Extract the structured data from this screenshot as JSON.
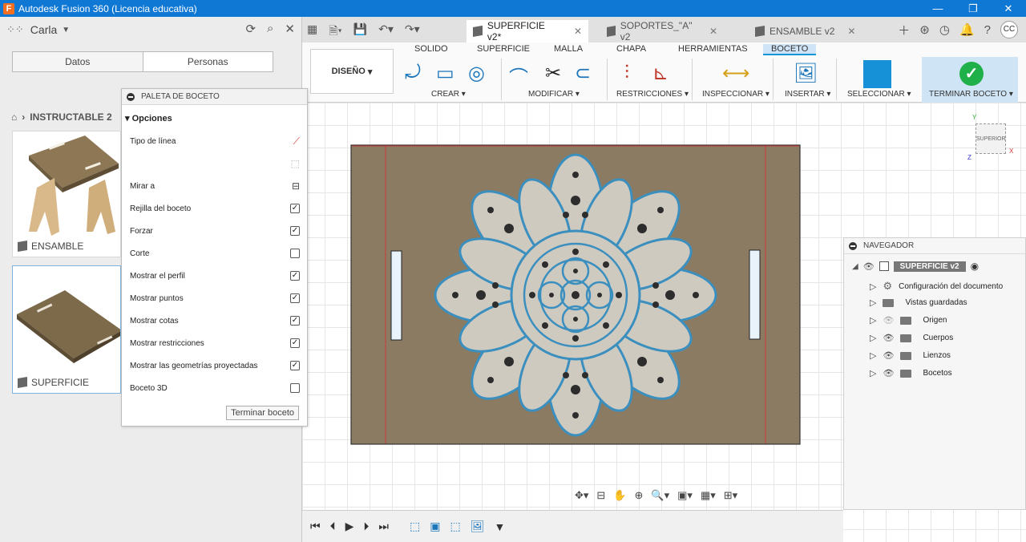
{
  "window": {
    "title": "Autodesk Fusion 360 (Licencia educativa)"
  },
  "data_panel": {
    "user": "Carla",
    "tabs": [
      "Datos",
      "Personas"
    ],
    "breadcrumb": "INSTRUCTABLE 2",
    "cards": [
      {
        "label": "ENSAMBLE"
      },
      {
        "label": "SUPERFICIE"
      }
    ]
  },
  "doc_tabs": [
    {
      "label": "SUPERFICIE v2*",
      "active": true
    },
    {
      "label": "SOPORTES_\"A\" v2",
      "active": false
    },
    {
      "label": "ENSAMBLE v2",
      "active": false
    }
  ],
  "user_initials": "CC",
  "ribbon": {
    "workspace": "DISEÑO",
    "tabs": [
      "SOLIDO",
      "SUPERFICIE",
      "MALLA",
      "CHAPA",
      "HERRAMIENTAS",
      "BOCETO"
    ],
    "active_tab": "BOCETO",
    "groups": [
      "CREAR",
      "MODIFICAR",
      "RESTRICCIONES",
      "INSPECCIONAR",
      "INSERTAR",
      "SELECCIONAR",
      "TERMINAR BOCETO"
    ]
  },
  "palette": {
    "title": "PALETA DE BOCETO",
    "section": "Opciones",
    "rows": [
      {
        "label": "Tipo de línea",
        "kind": "icon"
      },
      {
        "label": "",
        "kind": "icon"
      },
      {
        "label": "Mirar a",
        "kind": "icon"
      },
      {
        "label": "Rejilla del boceto",
        "kind": "checkbox",
        "checked": true
      },
      {
        "label": "Forzar",
        "kind": "checkbox",
        "checked": true
      },
      {
        "label": "Corte",
        "kind": "checkbox",
        "checked": false
      },
      {
        "label": "Mostrar el perfil",
        "kind": "checkbox",
        "checked": true
      },
      {
        "label": "Mostrar puntos",
        "kind": "checkbox",
        "checked": true
      },
      {
        "label": "Mostrar cotas",
        "kind": "checkbox",
        "checked": true
      },
      {
        "label": "Mostrar restricciones",
        "kind": "checkbox",
        "checked": true
      },
      {
        "label": "Mostrar las geometrías proyectadas",
        "kind": "checkbox",
        "checked": true
      },
      {
        "label": "Boceto 3D",
        "kind": "checkbox",
        "checked": false
      }
    ],
    "finish_button": "Terminar boceto"
  },
  "viewcube": {
    "face": "SUPERIOR"
  },
  "navigator": {
    "title": "NAVEGADOR",
    "root": "SUPERFICIE v2",
    "items": [
      {
        "label": "Configuración del documento",
        "icon": "gear-icon"
      },
      {
        "label": "Vistas guardadas",
        "icon": "folder-icon"
      },
      {
        "label": "Origen",
        "icon": "folder-icon"
      },
      {
        "label": "Cuerpos",
        "icon": "folder-icon"
      },
      {
        "label": "Lienzos",
        "icon": "folder-icon"
      },
      {
        "label": "Bocetos",
        "icon": "folder-icon"
      }
    ]
  },
  "colors": {
    "titlebar": "#0f78d4",
    "accent": "#0696d7",
    "board": "#8a7b62",
    "sketch_line": "#3b8fbf",
    "finish_check": "#1fb04a"
  }
}
